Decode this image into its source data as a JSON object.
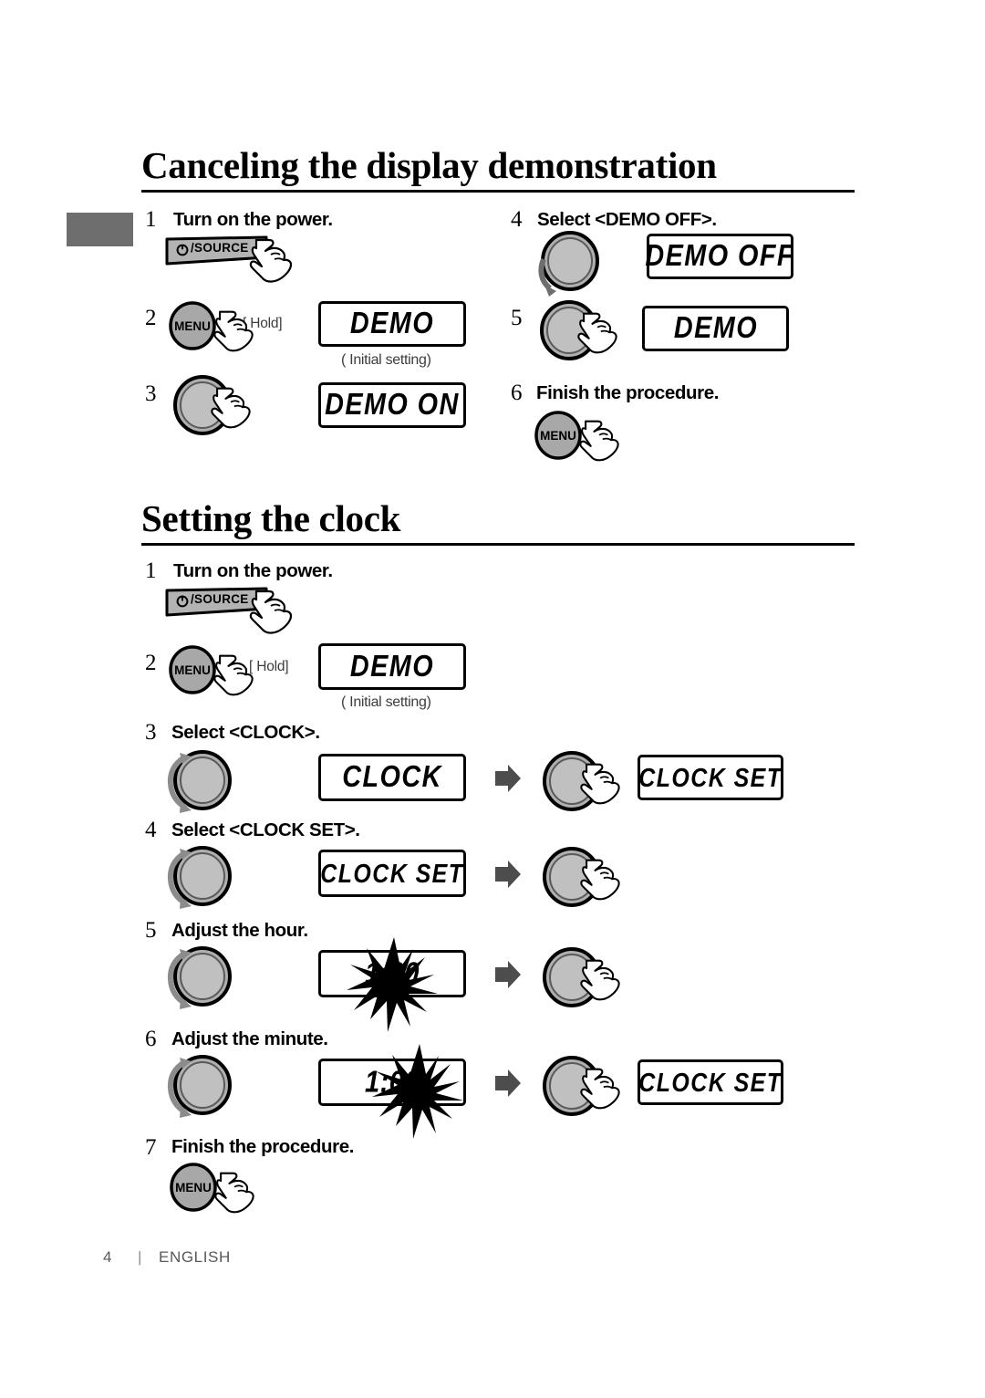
{
  "page": {
    "number": "4",
    "separator": "|",
    "language": "ENGLISH"
  },
  "sections": [
    {
      "id": "canceling-display-demonstration",
      "title": "Canceling the display demonstration",
      "steps": [
        {
          "num": "1",
          "text": "Turn on the power.",
          "control": "power-source-button",
          "press": true
        },
        {
          "num": "2",
          "text": "",
          "control": "menu-button",
          "press": true,
          "note": "[ Hold]",
          "display": "DEMO",
          "display_caption": "( Initial setting)"
        },
        {
          "num": "3",
          "text": "",
          "control": "knob-press",
          "press": true,
          "display": "DEMO ON"
        },
        {
          "num": "4",
          "text": "Select <DEMO OFF>.",
          "control": "knob-rotate",
          "display": "DEMO OFF"
        },
        {
          "num": "5",
          "text": "",
          "control": "knob-press",
          "press": true,
          "display": "DEMO"
        },
        {
          "num": "6",
          "text": "Finish the procedure.",
          "control": "menu-button",
          "press": true
        }
      ]
    },
    {
      "id": "setting-the-clock",
      "title": "Setting the clock",
      "steps": [
        {
          "num": "1",
          "text": "Turn on the power.",
          "control": "power-source-button",
          "press": true
        },
        {
          "num": "2",
          "text": "",
          "control": "menu-button",
          "press": true,
          "note": "[ Hold]",
          "display": "DEMO",
          "display_caption": "( Initial setting)"
        },
        {
          "num": "3",
          "text": "Select <CLOCK>.",
          "control": "knob-rotate",
          "display": "CLOCK",
          "then_display": "CLOCK SET"
        },
        {
          "num": "4",
          "text": "Select <CLOCK SET>.",
          "control": "knob-rotate",
          "display": "CLOCK SET",
          "then_display": ""
        },
        {
          "num": "5",
          "text": "Adjust the hour.",
          "control": "knob-rotate",
          "display": "1:00",
          "flash": "hour",
          "then_display": ""
        },
        {
          "num": "6",
          "text": "Adjust the minute.",
          "control": "knob-rotate",
          "display": "1:00",
          "flash": "minute",
          "then_display": "CLOCK SET"
        },
        {
          "num": "7",
          "text": "Finish the procedure.",
          "control": "menu-button",
          "press": true
        }
      ]
    }
  ],
  "labels": {
    "power_source": "/SOURCE",
    "power_glyph": "⏻",
    "menu": "MENU",
    "hold": "[ Hold]",
    "initial_setting": "( Initial setting)",
    "demo": "DEMO",
    "demo_on": "DEMO ON",
    "demo_off": "DEMO OFF",
    "clock": "CLOCK",
    "clock_set": "CLOCK SET",
    "time": "1:00",
    "time_hour": "1:",
    "time_minute": "00"
  },
  "colors": {
    "ink": "#000000",
    "tab_gray": "#6e6e6e",
    "button_gray": "#b3b3b3",
    "knob_gray": "#b0b0b0",
    "arrow_gray": "#4d4d4d",
    "caption_gray": "#3d3d3d",
    "footer_gray": "#58585a"
  }
}
